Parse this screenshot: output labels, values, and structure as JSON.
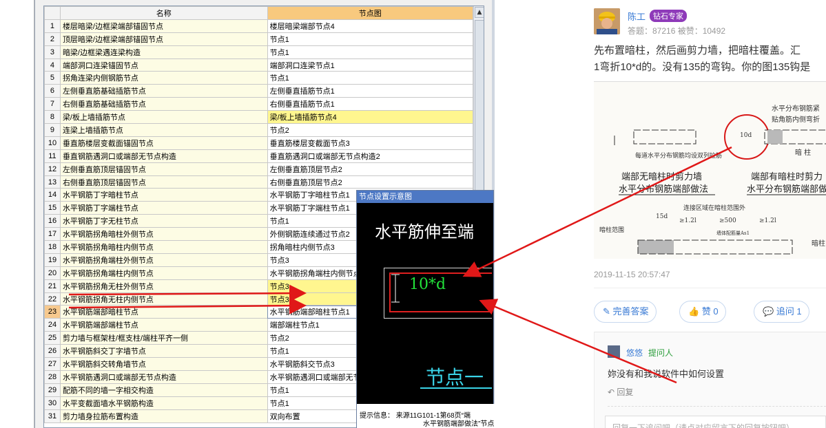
{
  "grid": {
    "header": {
      "name": "名称",
      "node": "节点图"
    },
    "rows": [
      {
        "num": "1",
        "name": "楼层暗梁/边框梁端部锚固节点",
        "node": "楼层暗梁端部节点4"
      },
      {
        "num": "2",
        "name": "顶层暗梁/边框梁端部锚固节点",
        "node": "节点1"
      },
      {
        "num": "3",
        "name": "暗梁/边框梁遇连梁构造",
        "node": "节点1"
      },
      {
        "num": "4",
        "name": "端部洞口连梁锚固节点",
        "node": "端部洞口连梁节点1"
      },
      {
        "num": "5",
        "name": "拐角连梁内侧钢筋节点",
        "node": "节点1"
      },
      {
        "num": "6",
        "name": "左侧垂直筋基础插筋节点",
        "node": "左侧垂直插筋节点1"
      },
      {
        "num": "7",
        "name": "右侧垂直筋基础插筋节点",
        "node": "右侧垂直插筋节点1"
      },
      {
        "num": "8",
        "name": "梁/板上墙插筋节点",
        "node": "梁/板上墙插筋节点4"
      },
      {
        "num": "9",
        "name": "连梁上墙插筋节点",
        "node": "节点2"
      },
      {
        "num": "10",
        "name": "垂直筋楼层变截面锚固节点",
        "node": "垂直筋楼层变截面节点3"
      },
      {
        "num": "11",
        "name": "垂直钢筋遇洞口或端部无节点构造",
        "node": "垂直筋遇洞口或端部无节点构造2"
      },
      {
        "num": "12",
        "name": "左侧垂直筋顶层锚固节点",
        "node": "左侧垂直筋顶层节点2"
      },
      {
        "num": "13",
        "name": "右侧垂直筋顶层锚固节点",
        "node": "右侧垂直筋顶层节点2"
      },
      {
        "num": "14",
        "name": "水平钢筋丁字暗柱节点",
        "node": "水平钢筋丁字暗柱节点1"
      },
      {
        "num": "15",
        "name": "水平钢筋丁字端柱节点",
        "node": "水平钢筋丁字端柱节点1"
      },
      {
        "num": "16",
        "name": "水平钢筋丁字无柱节点",
        "node": "节点1"
      },
      {
        "num": "17",
        "name": "水平钢筋拐角暗柱外侧节点",
        "node": "外侧钢筋连续通过节点2"
      },
      {
        "num": "18",
        "name": "水平钢筋拐角暗柱内侧节点",
        "node": "拐角暗柱内侧节点3"
      },
      {
        "num": "19",
        "name": "水平钢筋拐角端柱外侧节点",
        "node": "节点3"
      },
      {
        "num": "20",
        "name": "水平钢筋拐角端柱内侧节点",
        "node": "水平钢筋拐角端柱内侧节点1"
      },
      {
        "num": "21",
        "name": "水平钢筋拐角无柱外侧节点",
        "node": "节点3"
      },
      {
        "num": "22",
        "name": "水平钢筋拐角无柱内侧节点",
        "node": "节点3"
      },
      {
        "num": "23",
        "name": "水平钢筋端部暗柱节点",
        "node": "水平钢筋端部暗柱节点1"
      },
      {
        "num": "24",
        "name": "水平钢筋端部端柱节点",
        "node": "端部端柱节点1"
      },
      {
        "num": "25",
        "name": "剪力墙与框架柱/框支柱/端柱平齐一侧",
        "node": "节点2"
      },
      {
        "num": "26",
        "name": "水平钢筋斜交丁字墙节点",
        "node": "节点1"
      },
      {
        "num": "27",
        "name": "水平钢筋斜交转角墙节点",
        "node": "水平钢筋斜交节点3"
      },
      {
        "num": "28",
        "name": "水平钢筋遇洞口或端部无节点构造",
        "node": "水平钢筋遇洞口或端部无节点构"
      },
      {
        "num": "29",
        "name": "配筋不同的墙一字相交构造",
        "node": "节点1"
      },
      {
        "num": "30",
        "name": "水平变截面墙水平钢筋构造",
        "node": "节点1"
      },
      {
        "num": "31",
        "name": "剪力墙身拉筋布置构造",
        "node": "双向布置"
      }
    ]
  },
  "dialog": {
    "title": "节点设置示意图",
    "heading": "水平筋伸至端",
    "formula": "10*d",
    "node_label": "节点一",
    "info": "提示信息：  来源11G101-1第68页“端",
    "info2": "水平钢筋端部做法”节点"
  },
  "qa": {
    "author": "陈工",
    "badge": "钻石专家",
    "stats": "答题：87216   被赞：10492",
    "answer_line1": "先布置暗柱，然后画剪力墙，把暗柱覆盖。汇",
    "answer_line2": "1弯折10*d的。没有135的弯钩。你的图135钩是",
    "image": {
      "top_label1": "水平分布钢筋紧",
      "top_label2": "贴角筋内侧弯折",
      "dim_10d": "10d",
      "note": "每道水平分布钢筋均设双列拉筋",
      "darkcol": "暗 柱",
      "cap1a": "端部无暗柱时剪力墙",
      "cap1b": "水平分布钢筋端部做法",
      "cap2a": "端部有暗柱时剪力",
      "cap2b": "水平分布钢筋端部做",
      "bottom_note": "连接区域在暗柱范围外",
      "dim_15d": "15d",
      "dim_1": "≥1.2l",
      "dim_500": "≥500",
      "dim_2": "≥1.2l",
      "darkrange": "暗柱范围",
      "dark_right": "暗柱",
      "rebar_note": "墙体配筋量As1"
    },
    "time": "2019-11-15 20:57:47",
    "btn_complete": "完善答案",
    "btn_like": "赞 0",
    "btn_ask": "追问 1",
    "comment": {
      "name": "悠悠",
      "role": "提问人",
      "text": "妳没有和我说软件中如何设置",
      "reply": "回复"
    },
    "reply_placeholder": "回复一下追问吧（请点对应留言下的回复按钮吧）"
  },
  "colors": {
    "accent": "#3a7bd5",
    "arrow": "#e01818",
    "badge": "#8e3ab9",
    "cad_green": "#22e03a",
    "cad_cyan": "#3ad4e8"
  }
}
